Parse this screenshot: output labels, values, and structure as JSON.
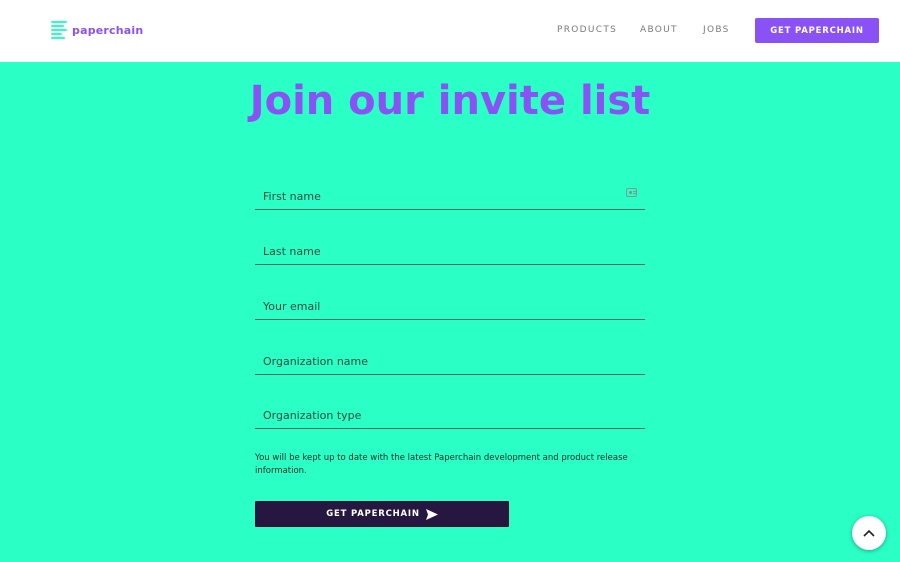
{
  "brand": {
    "name": "paperchain",
    "color": "#8a52f5",
    "accent": "#2affc6"
  },
  "nav": {
    "items": [
      {
        "label": "PRODUCTS"
      },
      {
        "label": "ABOUT"
      },
      {
        "label": "JOBS"
      }
    ],
    "cta_label": "GET PAPERCHAIN"
  },
  "page": {
    "title": "Join our invite list",
    "background": "#2affc6"
  },
  "form": {
    "fields": [
      {
        "placeholder": "First name",
        "value": ""
      },
      {
        "placeholder": "Last name",
        "value": ""
      },
      {
        "placeholder": "Your email",
        "value": ""
      },
      {
        "placeholder": "Organization name",
        "value": ""
      },
      {
        "placeholder": "Organization type",
        "value": ""
      }
    ],
    "disclaimer": "You will be kept up to date with the latest Paperchain development and product release information.",
    "submit_label": "GET PAPERCHAIN",
    "submit_color": "#251740"
  },
  "icons": {
    "autofill": "contact-card-icon",
    "submit": "send-icon",
    "scroll": "chevron-up-icon"
  }
}
